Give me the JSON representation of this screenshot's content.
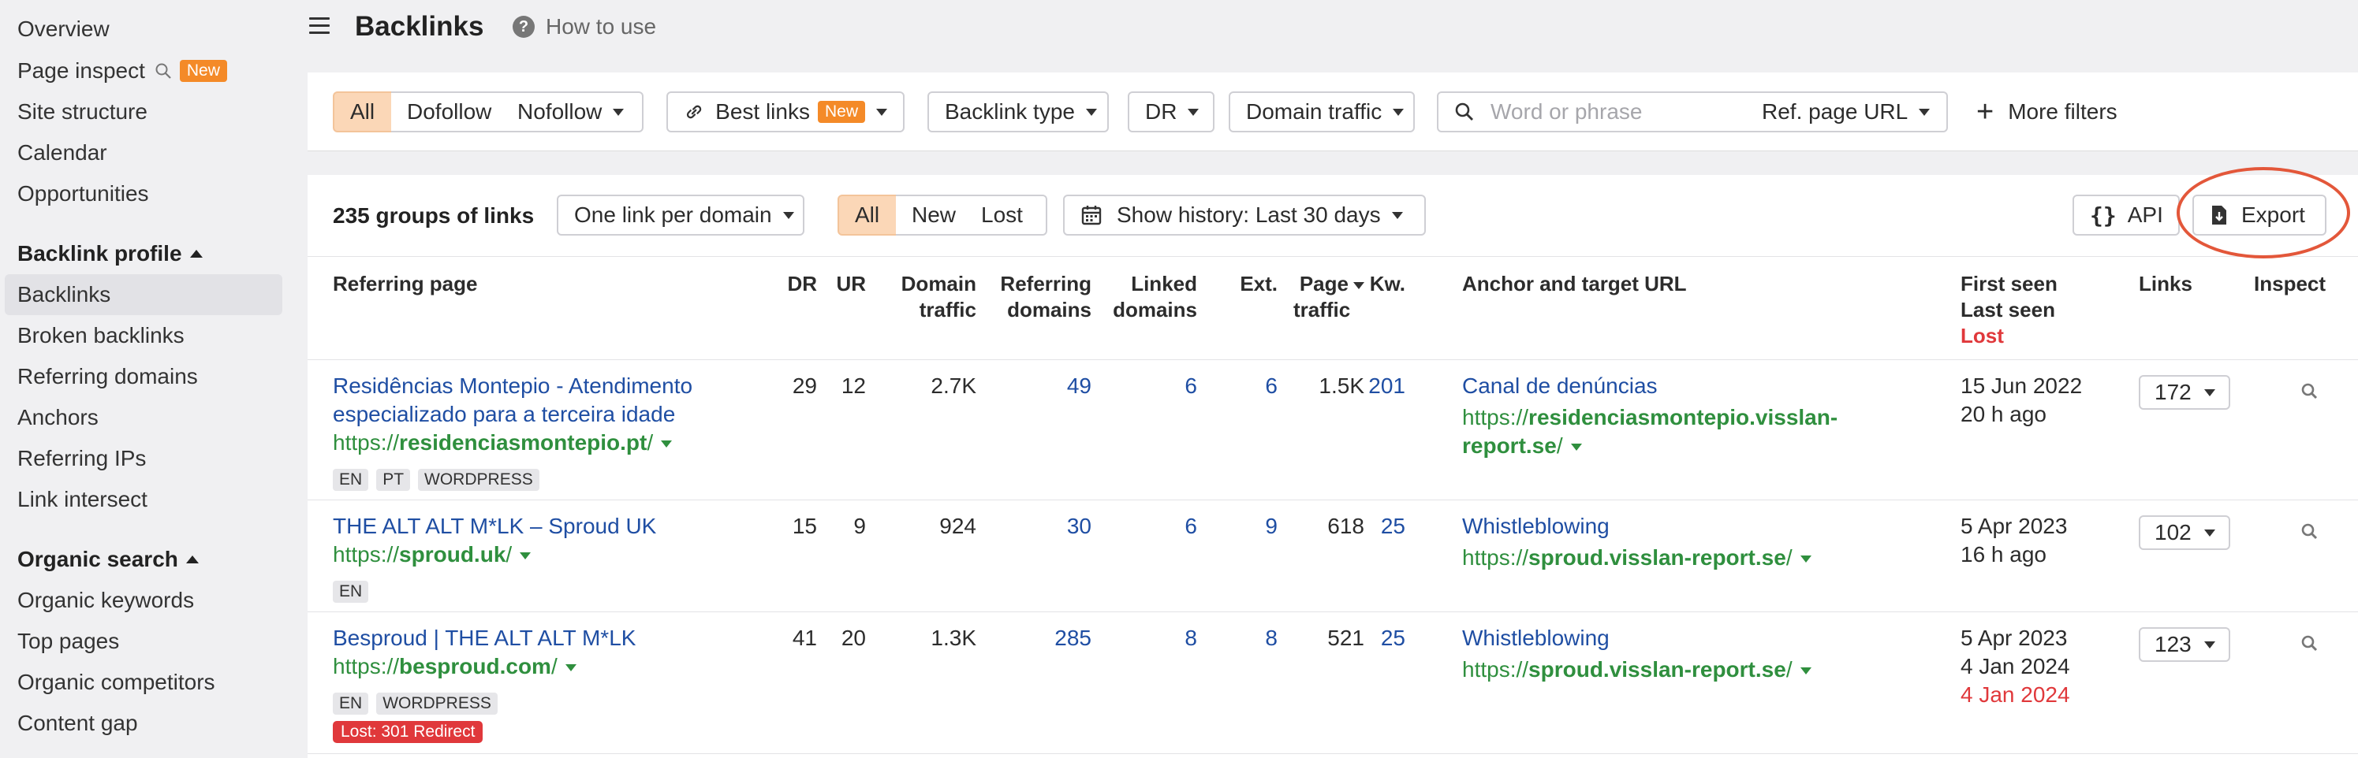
{
  "sidebar": {
    "top_items": [
      {
        "label": "Overview"
      },
      {
        "label": "Page inspect",
        "badge": "New"
      },
      {
        "label": "Site structure"
      },
      {
        "label": "Calendar"
      },
      {
        "label": "Opportunities"
      }
    ],
    "backlink_profile": {
      "heading": "Backlink profile",
      "items": [
        "Backlinks",
        "Broken backlinks",
        "Referring domains",
        "Anchors",
        "Referring IPs",
        "Link intersect"
      ]
    },
    "organic_search": {
      "heading": "Organic search",
      "items": [
        "Organic keywords",
        "Top pages",
        "Organic competitors",
        "Content gap"
      ]
    }
  },
  "header": {
    "title": "Backlinks",
    "how_to_use": "How to use",
    "help_glyph": "?"
  },
  "filters": {
    "all": "All",
    "dofollow": "Dofollow",
    "nofollow": "Nofollow",
    "best_links": "Best links",
    "best_links_badge": "New",
    "backlink_type": "Backlink type",
    "dr": "DR",
    "domain_traffic": "Domain traffic",
    "search_placeholder": "Word or phrase",
    "ref_page_url": "Ref. page URL",
    "more_filters": "More filters",
    "plus_glyph": "+"
  },
  "toolbar": {
    "groups_count": "235 groups of links",
    "grouping": "One link per domain",
    "all": "All",
    "new": "New",
    "lost": "Lost",
    "history": "Show history: Last 30 days",
    "api": "API",
    "api_glyph": "{}",
    "export": "Export"
  },
  "columns": {
    "referring_page": "Referring page",
    "dr": "DR",
    "ur": "UR",
    "domain_traffic_1": "Domain",
    "domain_traffic_2": "traffic",
    "referring_domains_1": "Referring",
    "referring_domains_2": "domains",
    "linked_domains_1": "Linked",
    "linked_domains_2": "domains",
    "ext": "Ext.",
    "page_traffic_1": "Page",
    "page_traffic_2": "traffic",
    "kw": "Kw.",
    "anchor": "Anchor and target URL",
    "first_seen": "First seen",
    "last_seen": "Last seen",
    "lost": "Lost",
    "links": "Links",
    "inspect": "Inspect"
  },
  "rows": [
    {
      "title_1": "Residências Montepio - Atendimento",
      "title_2": "especializado para a terceira idade",
      "url_prefix": "https://",
      "url_bold": "residenciasmontepio.pt",
      "url_suffix": "/",
      "tags": [
        "EN",
        "PT",
        "WORDPRESS"
      ],
      "dr": "29",
      "ur": "12",
      "domain_traffic": "2.7K",
      "referring_domains": "49",
      "linked_domains": "6",
      "ext": "6",
      "page_traffic": "1.5K",
      "kw": "201",
      "anchor": "Canal de denúncias",
      "target_prefix": "https://",
      "target_bold_1": "residenciasmontepio.visslan-",
      "target_bold_2": "report.se",
      "target_suffix": "/",
      "first_seen": "15 Jun 2022",
      "last_seen": "20 h ago",
      "links": "172"
    },
    {
      "title_1": "THE ALT ALT M*LK – Sproud UK",
      "url_prefix": "https://",
      "url_bold": "sproud.uk",
      "url_suffix": "/",
      "tags": [
        "EN"
      ],
      "dr": "15",
      "ur": "9",
      "domain_traffic": "924",
      "referring_domains": "30",
      "linked_domains": "6",
      "ext": "9",
      "page_traffic": "618",
      "kw": "25",
      "anchor": "Whistleblowing",
      "target_prefix": "https://",
      "target_bold": "sproud.visslan-report.se",
      "target_suffix": "/",
      "first_seen": "5 Apr 2023",
      "last_seen": "16 h ago",
      "links": "102"
    },
    {
      "title_1": "Besproud | THE ALT ALT M*LK",
      "url_prefix": "https://",
      "url_bold": "besproud.com",
      "url_suffix": "/",
      "tags": [
        "EN",
        "WORDPRESS"
      ],
      "lost_tag": "Lost: 301 Redirect",
      "dr": "41",
      "ur": "20",
      "domain_traffic": "1.3K",
      "referring_domains": "285",
      "linked_domains": "8",
      "ext": "8",
      "page_traffic": "521",
      "kw": "25",
      "anchor": "Whistleblowing",
      "target_prefix": "https://",
      "target_bold": "sproud.visslan-report.se",
      "target_suffix": "/",
      "first_seen": "5 Apr 2023",
      "last_seen": "4 Jan 2024",
      "lost_date": "4 Jan 2024",
      "links": "123"
    }
  ],
  "colors": {
    "accent_orange": "#f48a28",
    "selected_bg": "#fbd7b7",
    "link_blue": "#1f4ea3",
    "url_green": "#2f8f3e",
    "lost_red": "#e0383b",
    "highlight_ring": "#e3573a"
  }
}
